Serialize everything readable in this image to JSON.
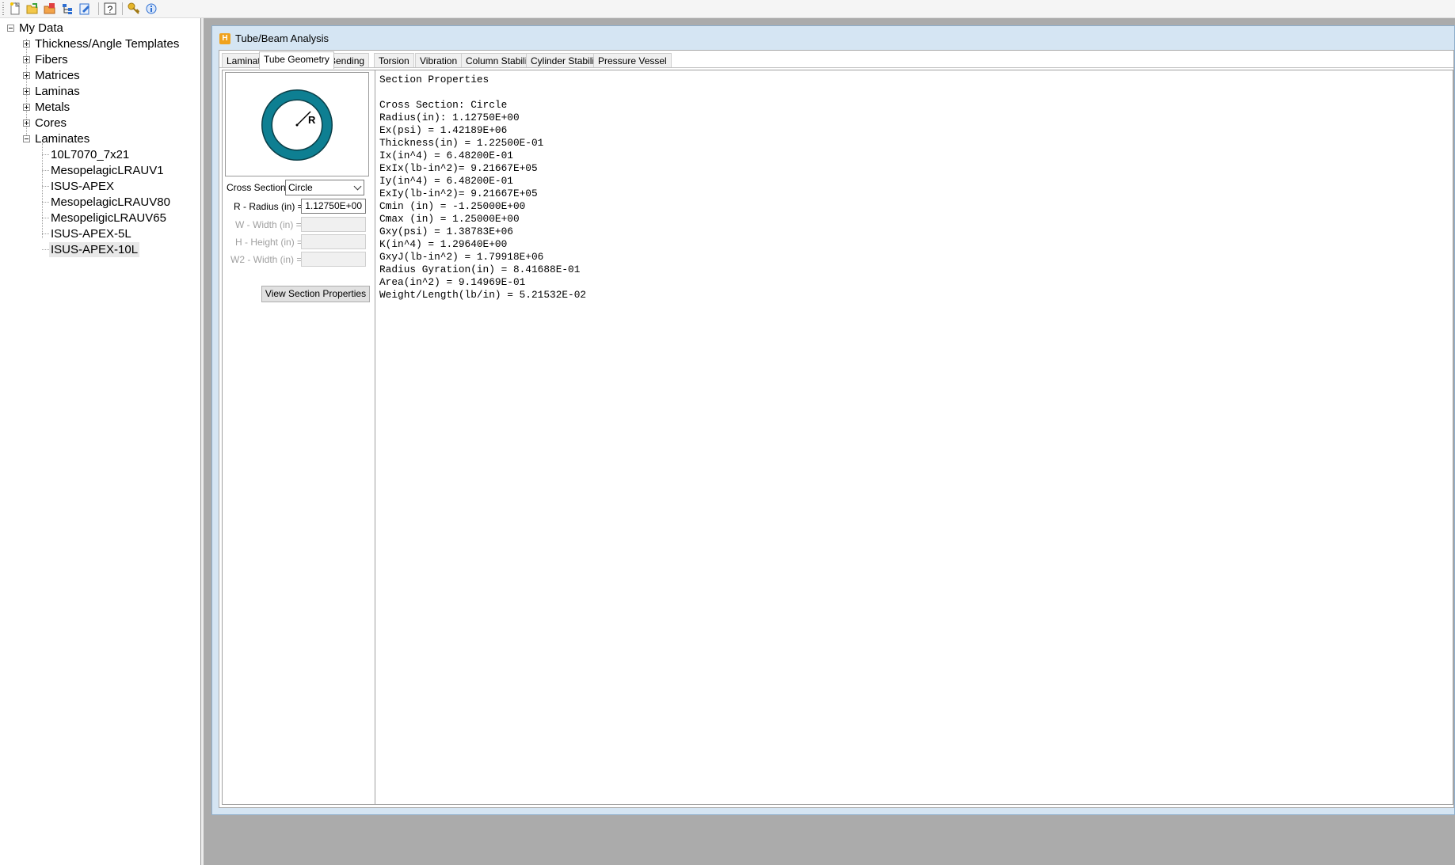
{
  "toolbar": {
    "icons": [
      "new-file-icon",
      "open-folder-icon",
      "open-recent-icon",
      "hierarchy-icon",
      "edit-document-icon",
      "help-icon",
      "key-icon",
      "info-icon"
    ]
  },
  "tree": {
    "root": "My Data",
    "groups": [
      "Thickness/Angle Templates",
      "Fibers",
      "Matrices",
      "Laminas",
      "Metals",
      "Cores",
      "Laminates"
    ],
    "laminates": [
      "10L7070_7x21",
      "MesopelagicLRAUV1",
      "ISUS-APEX",
      "MesopelagicLRAUV80",
      "MesopeligicLRAUV65",
      "ISUS-APEX-5L",
      "ISUS-APEX-10L"
    ],
    "selected": "ISUS-APEX-10L"
  },
  "window": {
    "title": "Tube/Beam Analysis",
    "icon_letter": "H",
    "tabs": [
      "Laminate",
      "Tube Geometry",
      "Bending",
      "Torsion",
      "Vibration",
      "Column Stability",
      "Cylinder Stability",
      "Pressure Vessel"
    ],
    "active_tab": "Tube Geometry"
  },
  "geometry": {
    "diagram_label": "R",
    "cross_section_label": "Cross Section",
    "cross_section_value": "Circle",
    "radius_label": "R - Radius (in) =",
    "radius_value": "1.12750E+00",
    "width_label": "W - Width (in) =",
    "height_label": "H - Height (in) =",
    "w2_label": "W2 - Width (in) =",
    "view_button": "View Section Properties"
  },
  "colors": {
    "ring": "#0e7f92",
    "ring_outline": "#0b3f48"
  },
  "output": {
    "lines": [
      "Section Properties",
      "",
      "Cross Section: Circle",
      "Radius(in): 1.12750E+00",
      "Ex(psi) = 1.42189E+06",
      "Thickness(in) = 1.22500E-01",
      "Ix(in^4) = 6.48200E-01",
      "ExIx(lb-in^2)= 9.21667E+05",
      "Iy(in^4) = 6.48200E-01",
      "ExIy(lb-in^2)= 9.21667E+05",
      "Cmin (in) = -1.25000E+00",
      "Cmax (in) = 1.25000E+00",
      "Gxy(psi) = 1.38783E+06",
      "K(in^4) = 1.29640E+00",
      "GxyJ(lb-in^2) = 1.79918E+06",
      "Radius Gyration(in) = 8.41688E-01",
      "Area(in^2) = 9.14969E-01",
      "Weight/Length(lb/in) = 5.21532E-02"
    ]
  }
}
